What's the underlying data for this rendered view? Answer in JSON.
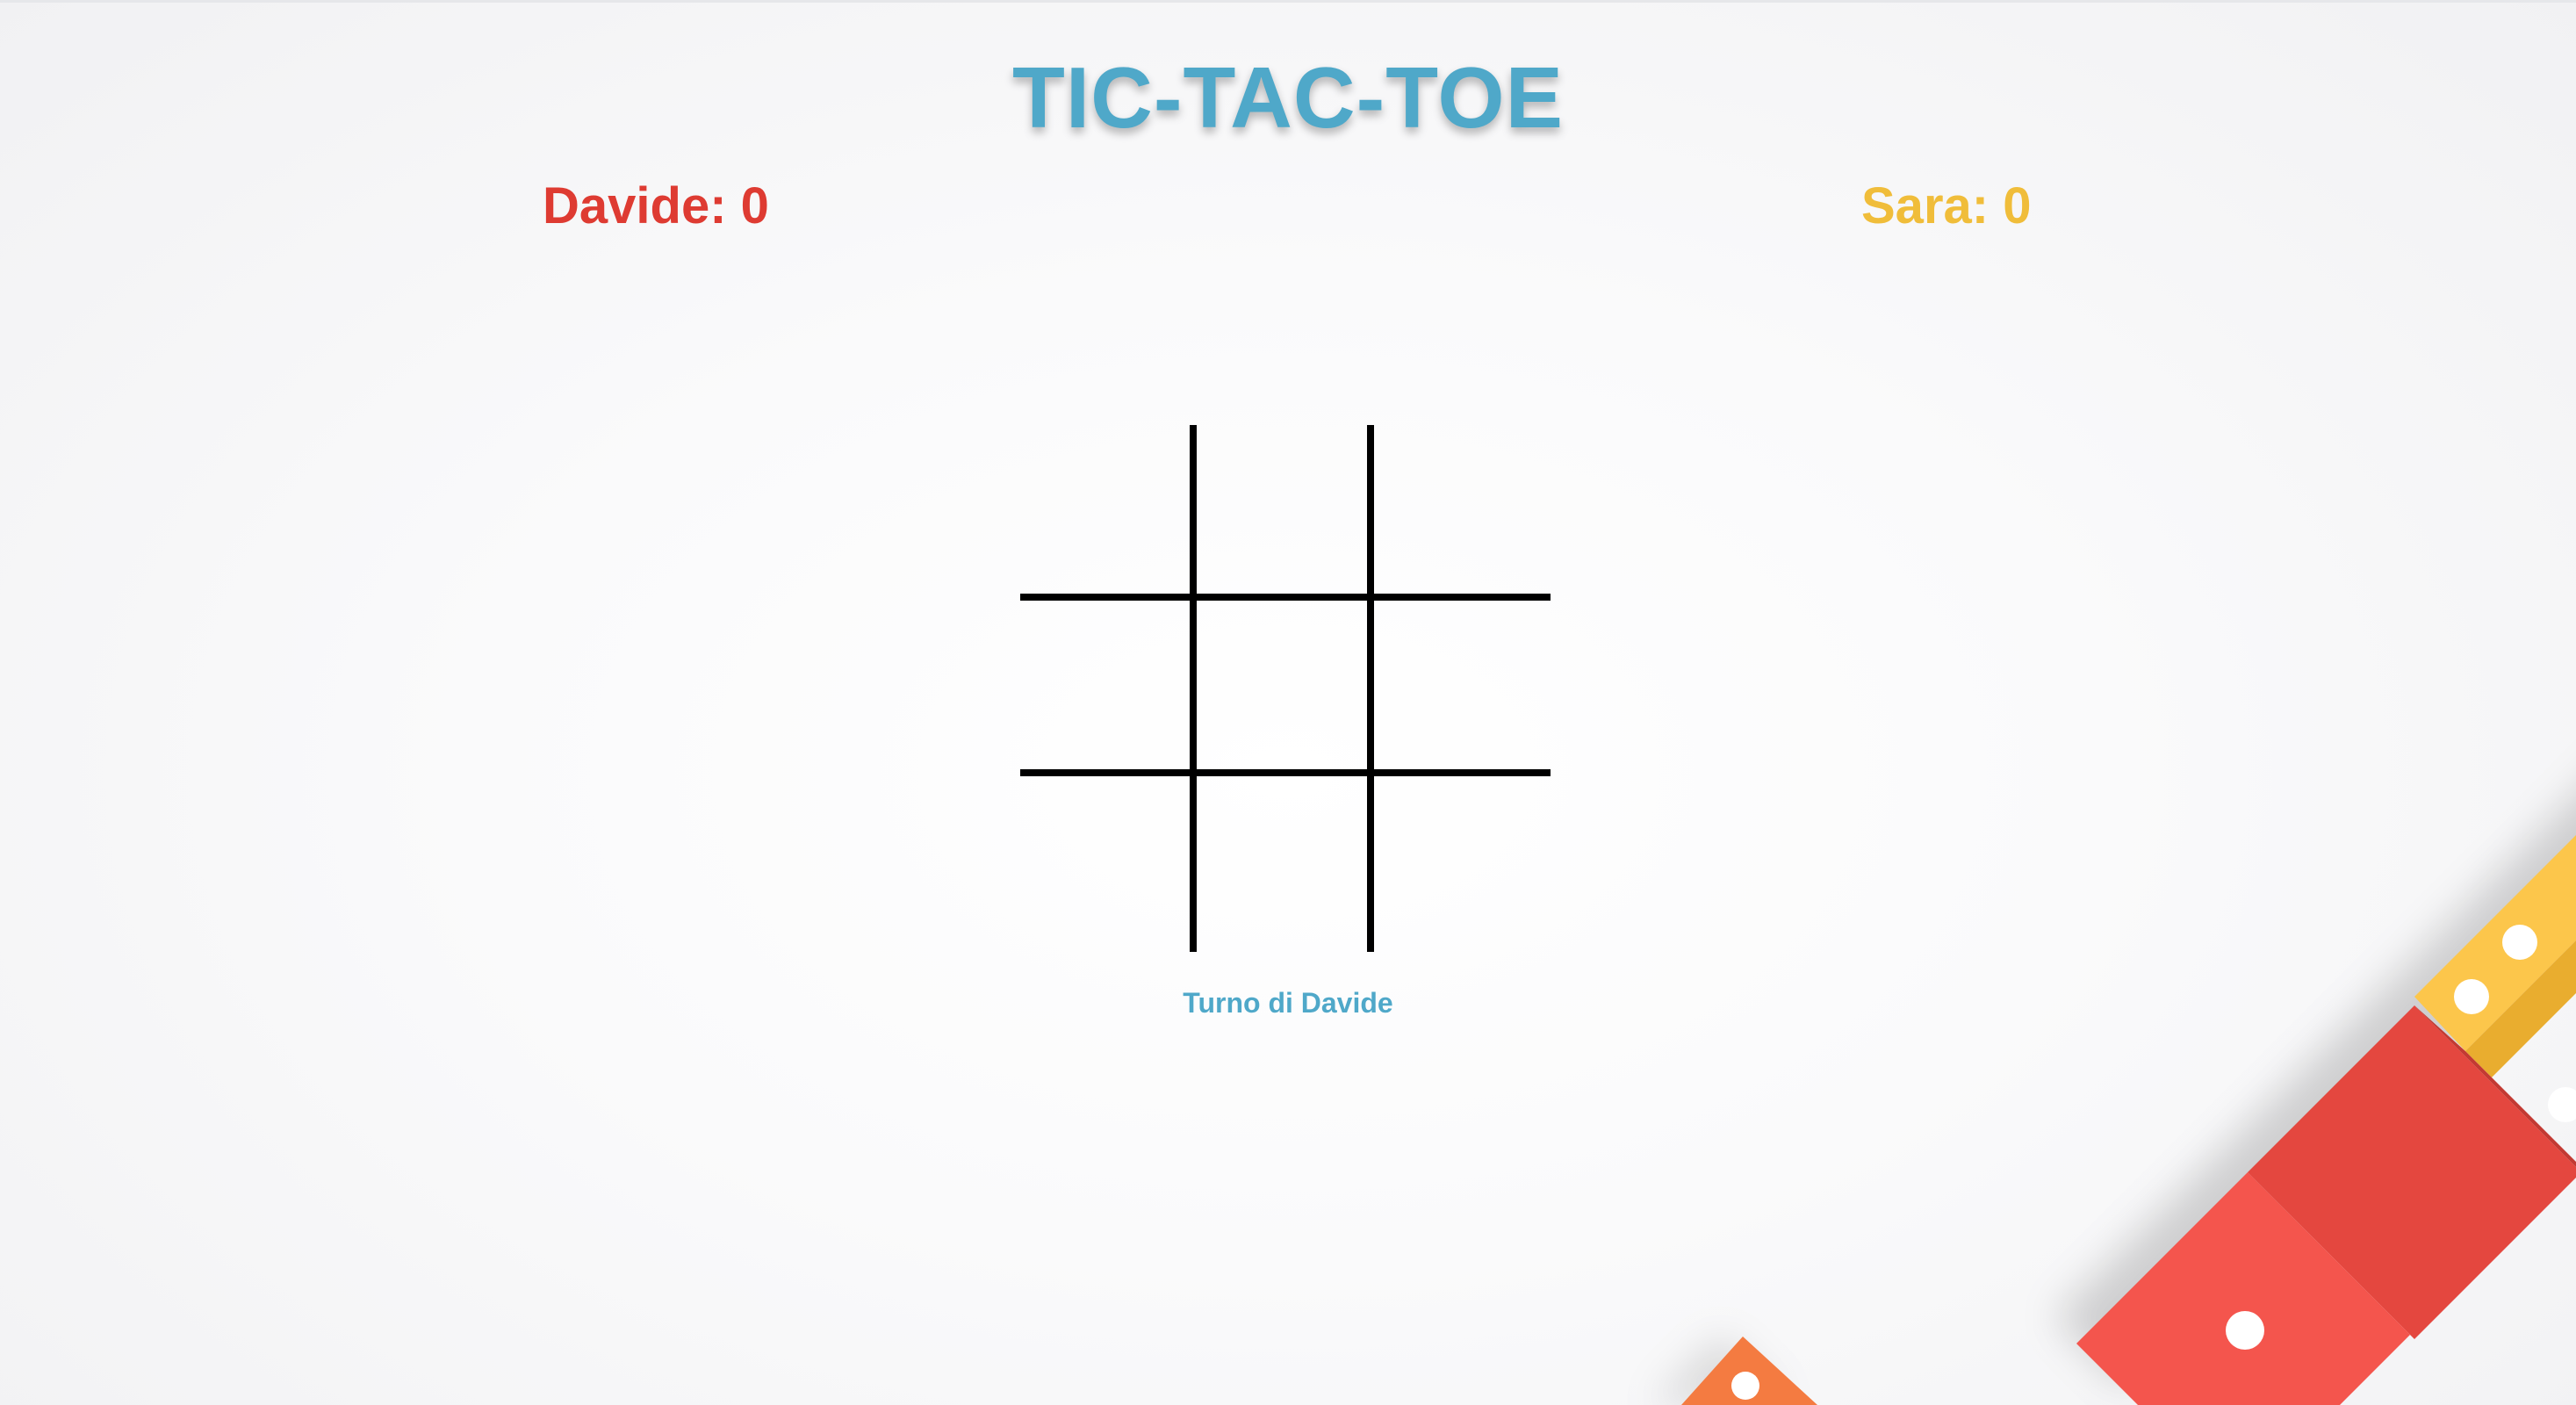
{
  "title": "TIC-TAC-TOE",
  "players": [
    {
      "label": "Davide: 0",
      "color": "#de3b32"
    },
    {
      "label": "Sara: 0",
      "color": "#f0bd3a"
    }
  ],
  "board": {
    "cells": [
      "",
      "",
      "",
      "",
      "",
      "",
      "",
      "",
      ""
    ]
  },
  "status": "Turno di Davide",
  "colors": {
    "accent": "#4fa8c9",
    "grid_lines": "#000000",
    "decoration_yellow": "#fcc64b",
    "decoration_red": "#e4473f",
    "decoration_orange": "#f47b41"
  }
}
